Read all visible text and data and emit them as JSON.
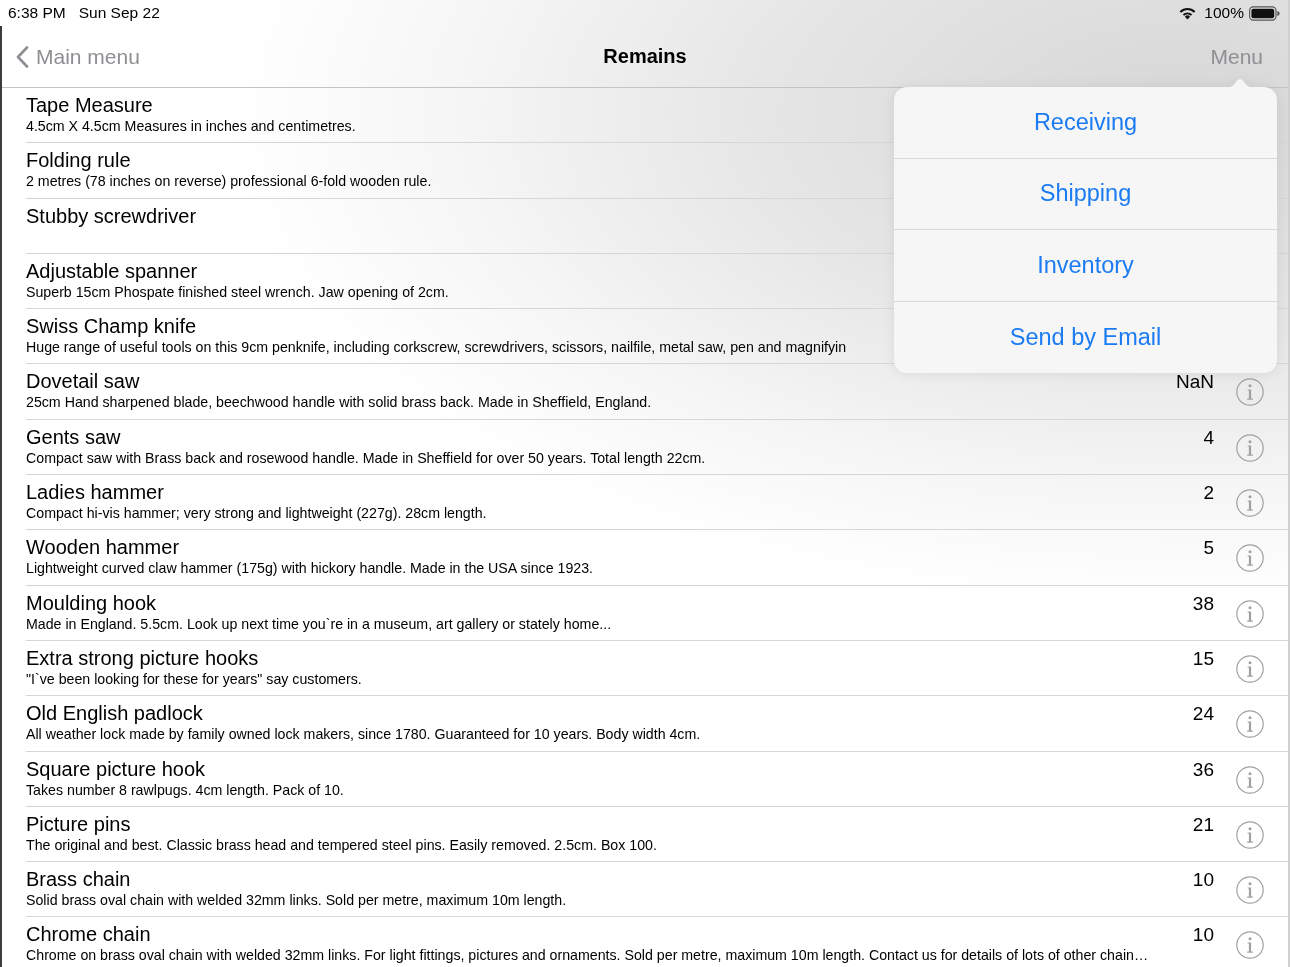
{
  "status_bar": {
    "time": "6:38 PM",
    "date": "Sun Sep 22",
    "battery": "100%"
  },
  "nav_bar": {
    "back_label": "Main menu",
    "title": "Remains",
    "menu_label": "Menu"
  },
  "rows": [
    {
      "title": "Tape Measure",
      "description": "4.5cm X 4.5cm Measures in inches and centimetres."
    },
    {
      "title": "Folding rule",
      "description": "2 metres (78 inches on reverse) professional 6-fold wooden rule."
    },
    {
      "title": "Stubby screwdriver"
    },
    {
      "title": "Adjustable spanner",
      "description": "Superb 15cm Phospate finished steel wrench. Jaw opening of 2cm."
    },
    {
      "title": "Swiss Champ knife",
      "description": "Huge range of useful tools on this 9cm penknife, including corkscrew, screwdrivers, scissors, nailfile, metal saw, pen and magnifyin"
    },
    {
      "title": "Dovetail saw",
      "description": "25cm Hand sharpened blade, beechwood handle with solid brass back. Made in Sheffield, England.",
      "count": "NaN"
    },
    {
      "title": "Gents saw",
      "description": "Compact saw with Brass back and rosewood handle. Made in Sheffield for over 50 years. Total length 22cm.",
      "count": "4"
    },
    {
      "title": "Ladies hammer",
      "description": "Compact hi-vis hammer; very strong and lightweight (227g). 28cm length.",
      "count": "2"
    },
    {
      "title": "Wooden hammer",
      "description": "Lightweight curved claw hammer (175g) with hickory handle. Made in the USA since 1923.",
      "count": "5"
    },
    {
      "title": "Moulding hook",
      "description": "Made in England. 5.5cm. Look up next time you`re in a museum, art gallery or stately home...",
      "count": "38"
    },
    {
      "title": "Extra strong picture hooks",
      "description": "\"I`ve been looking for these for years\" say customers.",
      "count": "15"
    },
    {
      "title": "Old English padlock",
      "description": "All weather lock made by family owned lock makers, since 1780. Guaranteed for 10 years. Body width 4cm.",
      "count": "24"
    },
    {
      "title": "Square picture hook",
      "description": "Takes number 8 rawlpugs. 4cm length. Pack of 10.",
      "count": "36"
    },
    {
      "title": "Picture pins",
      "description": "The original and best. Classic brass head and tempered steel pins. Easily removed. 2.5cm. Box 100.",
      "count": "21"
    },
    {
      "title": "Brass chain",
      "description": "Solid brass oval chain with welded 32mm links. Sold per metre, maximum 10m length.",
      "count": "10"
    },
    {
      "title": "Chrome chain",
      "description": "Chrome on brass oval chain with welded 32mm links. For light fittings, pictures and ornaments. Sold per metre, maximum 10m length. Contact us for details of lots of other chain…",
      "count": "10"
    }
  ],
  "popover": {
    "items": [
      "Receiving",
      "Shipping",
      "Inventory",
      "Send by Email"
    ]
  }
}
